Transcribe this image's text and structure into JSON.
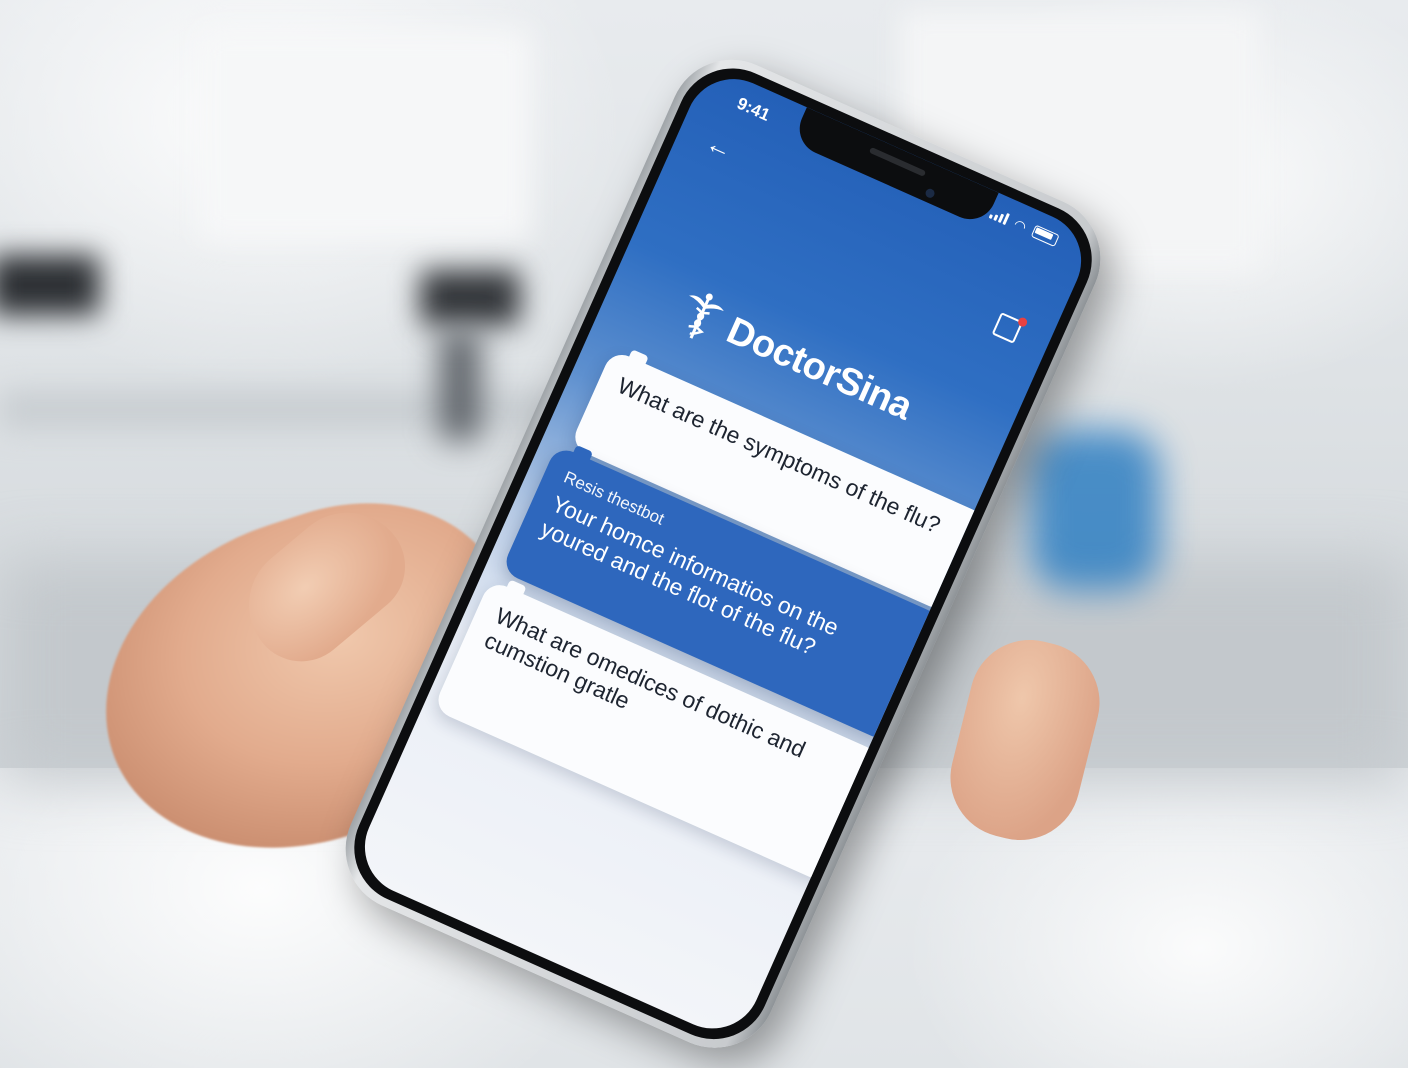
{
  "status_bar": {
    "time": "9:41",
    "signal_icon": "cellular-signal-icon",
    "wifi_icon": "wifi-icon",
    "battery_icon": "battery-icon"
  },
  "header": {
    "back_icon": "back-arrow-icon",
    "share_icon": "share-notification-icon",
    "logo_icon": "caduceus-icon",
    "app_name": "DoctorSina"
  },
  "chat": {
    "messages": [
      {
        "role": "user",
        "text": "What are the symptoms of the flu?"
      },
      {
        "role": "bot",
        "sender": "Resis thestbot",
        "text": "Your homce informatios on the youred and the flot of the flu?"
      },
      {
        "role": "user",
        "text": "What are omedices of dothic and cumstion gratle"
      }
    ]
  },
  "colors": {
    "header_blue": "#2460b8",
    "bot_bubble": "#2e67bd",
    "user_bubble": "#fbfcfe",
    "notification_dot": "#e84141"
  }
}
